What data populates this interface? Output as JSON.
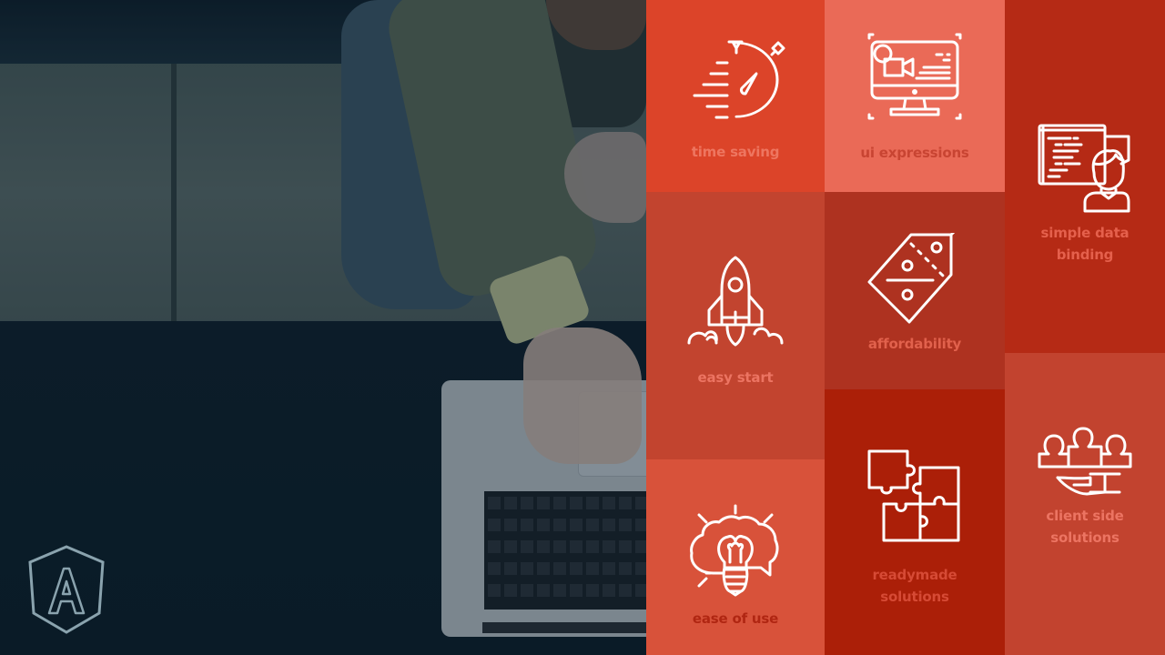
{
  "hero": {
    "photo_description": "Overhead view of a person using a laptop on a dark table",
    "logo_icon": "angular-shield-logo-icon"
  },
  "features": [
    {
      "id": "time-saving",
      "label": "time saving",
      "icon": "stopwatch-icon",
      "bg": "#dc4429"
    },
    {
      "id": "ui-expressions",
      "label": "ui expressions",
      "icon": "monitor-media-icon",
      "bg": "#ea6a57"
    },
    {
      "id": "simple-data-binding",
      "label": "simple data binding",
      "label_lines": [
        "simple data",
        "binding"
      ],
      "icon": "developer-code-icon",
      "bg": "#b52a15"
    },
    {
      "id": "easy-start",
      "label": "easy start",
      "icon": "rocket-icon",
      "bg": "#c2442f"
    },
    {
      "id": "affordability",
      "label": "affordability",
      "icon": "price-tag-percent-icon",
      "bg": "#ae3220"
    },
    {
      "id": "ease-of-use",
      "label": "ease of use",
      "icon": "brain-lightbulb-icon",
      "bg": "#d8523a"
    },
    {
      "id": "readymade-solutions",
      "label": "readymade solutions",
      "label_lines": [
        "readymade",
        "solutions"
      ],
      "icon": "puzzle-icon",
      "bg": "#ab1f08"
    },
    {
      "id": "client-side-solutions",
      "label": "client side solutions",
      "label_lines": [
        "client side",
        "solutions"
      ],
      "icon": "users-on-hand-icon",
      "bg": "#c2432f"
    }
  ]
}
